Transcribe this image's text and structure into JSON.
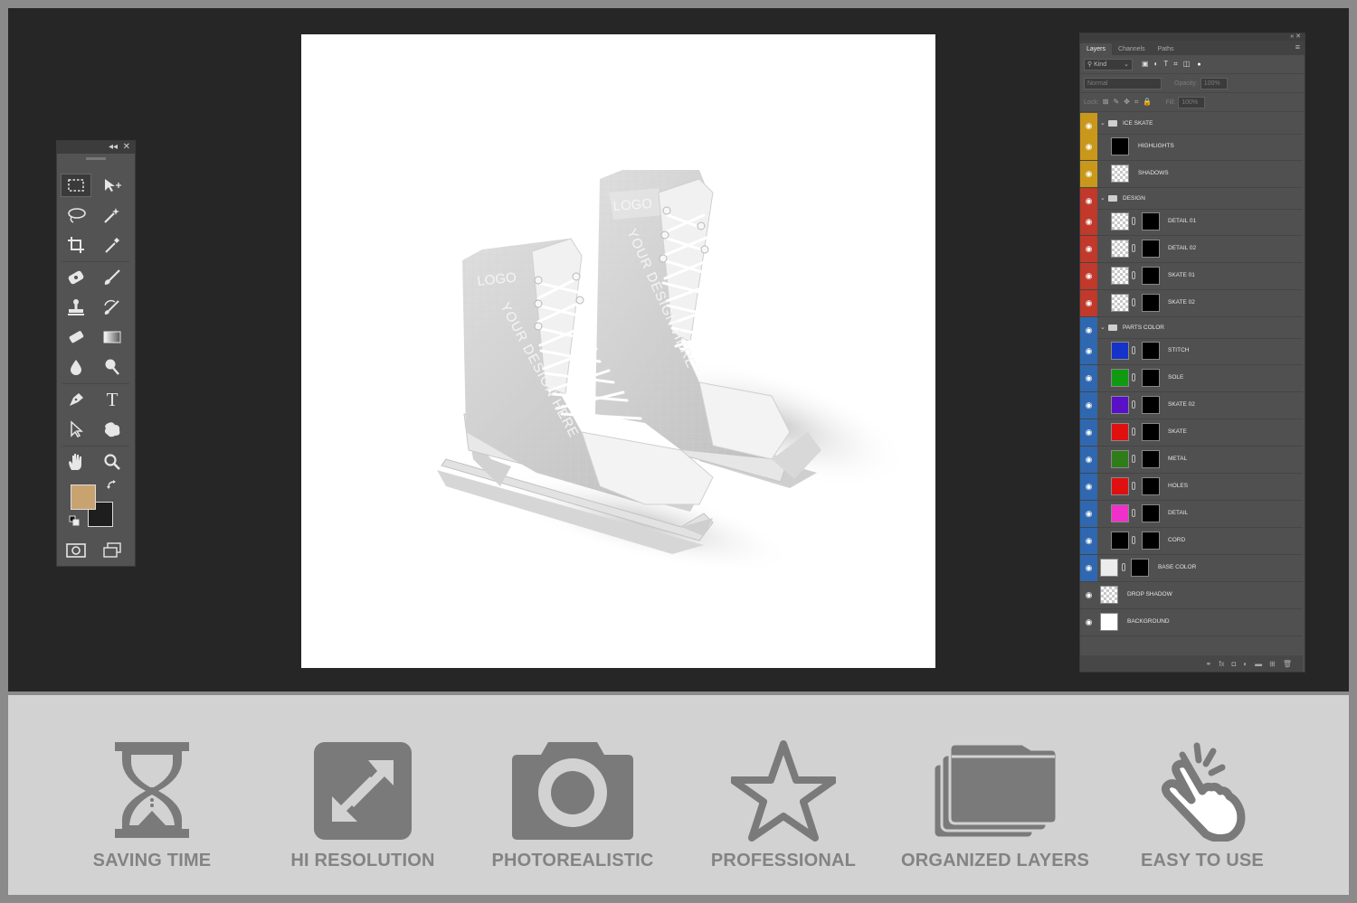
{
  "colors": {
    "frame": "#8a8a8a",
    "workspace": "#262626",
    "panel": "#505050",
    "feature_bar": "#d2d2d2",
    "feature_icon": "#7a7a7a",
    "foreground_swatch": "#c9a36f",
    "background_swatch": "#1e1e1e",
    "group_ice_skate": "#c9981a",
    "group_design": "#c0392b",
    "group_parts_color": "#2f68b0"
  },
  "toolbox": {
    "collapse_glyph": "◂◂",
    "close_glyph": "✕",
    "tools": [
      {
        "name": "rectangular-marquee-tool",
        "icon": "marquee-icon",
        "selected": true
      },
      {
        "name": "move-tool",
        "icon": "move-icon"
      },
      {
        "name": "lasso-tool",
        "icon": "lasso-icon"
      },
      {
        "name": "magic-wand-tool",
        "icon": "magic-wand-icon"
      },
      {
        "name": "crop-tool",
        "icon": "crop-icon"
      },
      {
        "name": "eyedropper-tool",
        "icon": "eyedropper-icon"
      },
      {
        "name": "healing-brush-tool",
        "icon": "healing-icon"
      },
      {
        "name": "brush-tool",
        "icon": "brush-icon"
      },
      {
        "name": "clone-stamp-tool",
        "icon": "stamp-icon"
      },
      {
        "name": "history-brush-tool",
        "icon": "history-brush-icon"
      },
      {
        "name": "eraser-tool",
        "icon": "eraser-icon"
      },
      {
        "name": "gradient-tool",
        "icon": "gradient-icon"
      },
      {
        "name": "blur-tool",
        "icon": "drop-icon"
      },
      {
        "name": "dodge-tool",
        "icon": "dodge-icon"
      },
      {
        "name": "pen-tool",
        "icon": "pen-icon"
      },
      {
        "name": "type-tool",
        "icon": "type-icon",
        "glyph": "T"
      },
      {
        "name": "path-selection-tool",
        "icon": "arrow-icon"
      },
      {
        "name": "custom-shape-tool",
        "icon": "shape-icon"
      },
      {
        "name": "hand-tool",
        "icon": "hand-icon"
      },
      {
        "name": "zoom-tool",
        "icon": "zoom-icon"
      }
    ]
  },
  "canvas": {
    "logo_text": "LOGO",
    "design_text": "YOUR DESIGN HERE"
  },
  "layers_panel": {
    "window_controls": "«  ✕",
    "tabs": [
      "Layers",
      "Channels",
      "Paths"
    ],
    "menu_glyph": "≡",
    "filter_kind": "Kind",
    "blend_mode": "Normal",
    "opacity_label": "Opacity:",
    "opacity_value": "100%",
    "lock_label": "Lock:",
    "fill_label": "Fill:",
    "fill_value": "100%",
    "groups": [
      {
        "name": "ICE SKATE",
        "color": "#c9981a",
        "layers": [
          {
            "name": "HIGHLIGHTS",
            "thumb": "#000000",
            "mask": false
          },
          {
            "name": "SHADOWS",
            "thumb": "checker",
            "mask": false
          }
        ]
      },
      {
        "name": "DESIGN",
        "color": "#c0392b",
        "layers": [
          {
            "name": "DETAIL 01",
            "thumb": "checker",
            "mask": true
          },
          {
            "name": "DETAIL 02",
            "thumb": "checker",
            "mask": true
          },
          {
            "name": "SKATE 01",
            "thumb": "checker",
            "mask": true
          },
          {
            "name": "SKATE 02",
            "thumb": "checker",
            "mask": true
          }
        ]
      },
      {
        "name": "PARTS COLOR",
        "color": "#2f68b0",
        "layers": [
          {
            "name": "STITCH",
            "thumb": "#1533c8",
            "mask": true
          },
          {
            "name": "SOLE",
            "thumb": "#119a11",
            "mask": true
          },
          {
            "name": "SKATE 02",
            "thumb": "#5a10c8",
            "mask": true
          },
          {
            "name": "SKATE",
            "thumb": "#e01010",
            "mask": true
          },
          {
            "name": "METAL",
            "thumb": "#2f7d1a",
            "mask": true
          },
          {
            "name": "HOLES",
            "thumb": "#e01010",
            "mask": true
          },
          {
            "name": "DETAIL",
            "thumb": "#f030c8",
            "mask": true
          },
          {
            "name": "CORD",
            "thumb": "#000000",
            "mask": true
          }
        ]
      }
    ],
    "base_layer": {
      "name": "BASE COLOR",
      "thumb": "#ececec"
    },
    "bottom_layers": [
      {
        "name": "DROP SHADOW",
        "thumb": "checker"
      },
      {
        "name": "BACKGROUND",
        "thumb": "#ffffff"
      }
    ],
    "footer_icons": [
      "link-icon",
      "fx-icon",
      "mask-icon",
      "adjustment-icon",
      "folder-icon",
      "new-layer-icon",
      "trash-icon"
    ],
    "footer_glyphs": [
      "⚭",
      "fx",
      "◘",
      "◐",
      "▬",
      "⊞",
      "🗑"
    ]
  },
  "features": [
    {
      "label": "SAVING TIME",
      "icon": "hourglass-icon"
    },
    {
      "label": "HI RESOLUTION",
      "icon": "expand-icon"
    },
    {
      "label": "PHOTOREALISTIC",
      "icon": "camera-icon"
    },
    {
      "label": "PROFESSIONAL",
      "icon": "star-icon"
    },
    {
      "label": "ORGANIZED LAYERS",
      "icon": "layers-icon"
    },
    {
      "label": "EASY TO USE",
      "icon": "hand-tap-icon"
    }
  ]
}
